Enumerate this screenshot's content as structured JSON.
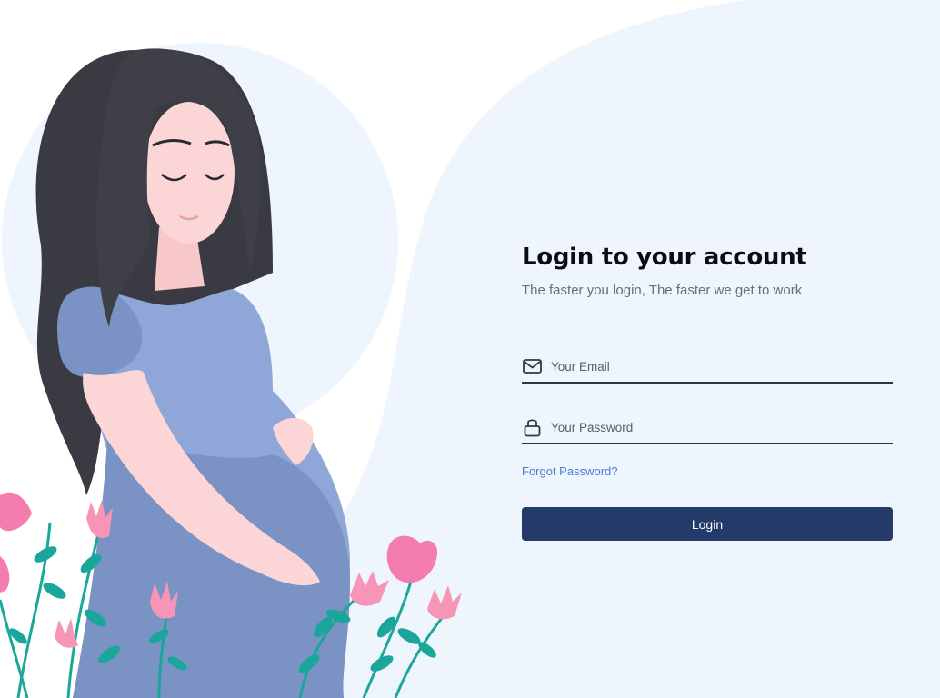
{
  "login": {
    "title": "Login to your account",
    "subtitle": "The faster you login, The faster we get to work",
    "email_placeholder": "Your Email",
    "password_placeholder": "Your Password",
    "forgot_label": "Forgot Password?",
    "login_label": "Login"
  },
  "icons": {
    "email": "envelope-icon",
    "password": "lock-icon"
  },
  "colors": {
    "background_blob": "#eef5fd",
    "accent": "#243a69",
    "link": "#4a7fd1",
    "dress": "#8fa7d8",
    "skin": "#fcd6d6",
    "hair": "#3a3a42",
    "flower_pink": "#f47cae",
    "leaf_teal": "#1aa69a"
  }
}
